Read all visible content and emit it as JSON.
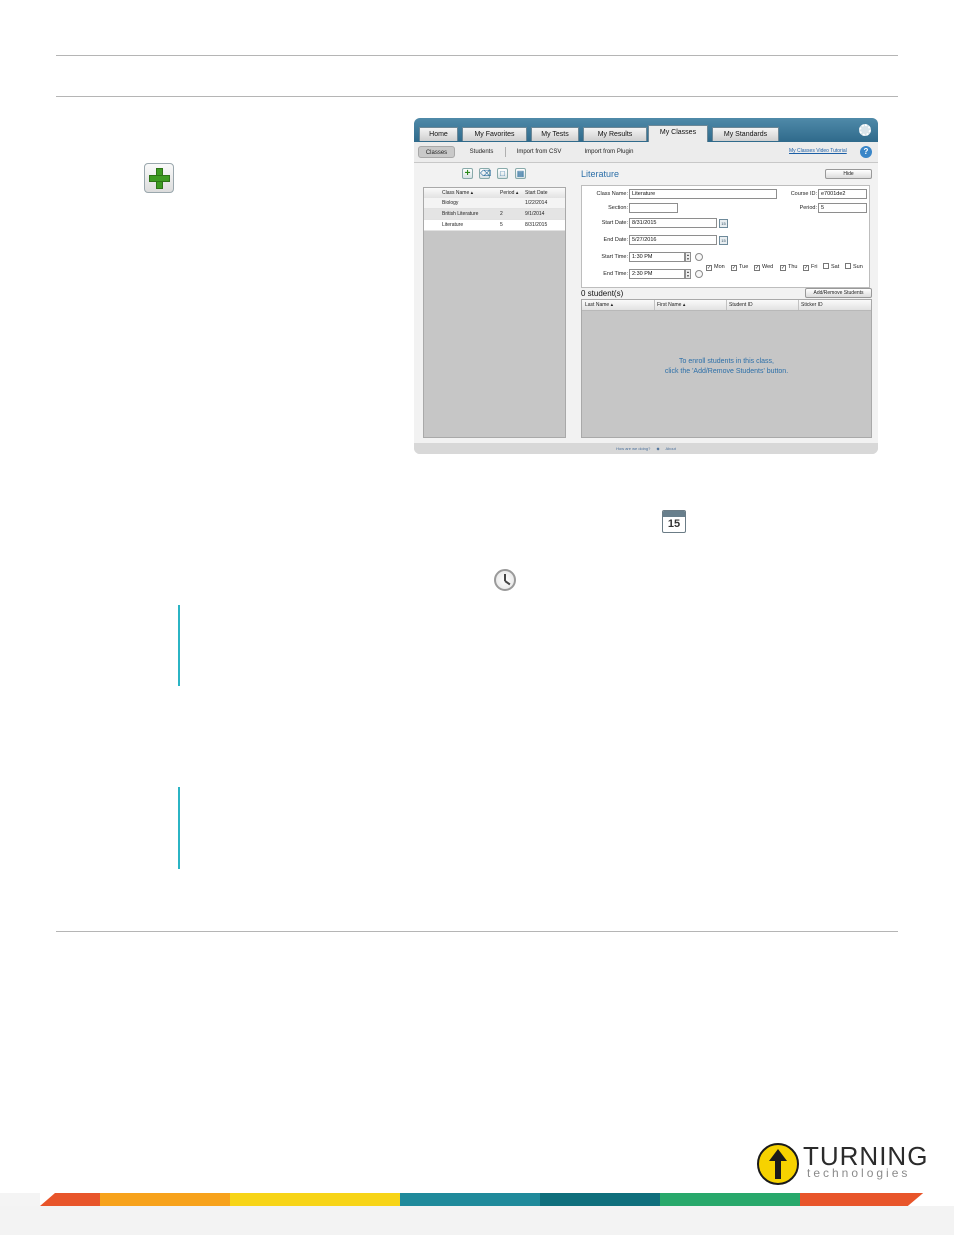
{
  "app": {
    "tabs": [
      "Home",
      "My Favorites",
      "My Tests",
      "My Results",
      "My Classes",
      "My Standards"
    ],
    "active_tab": "My Classes",
    "subtabs": [
      "Classes",
      "Students",
      "Import from CSV",
      "Import from Plugin"
    ],
    "video_link": "My Classes Video Tutorial",
    "help": "?",
    "class_table": {
      "headers": [
        "Class Name ▴",
        "Period ▴",
        "Start Date"
      ],
      "rows": [
        [
          "Biology",
          "",
          "1/22/2014"
        ],
        [
          "British Literature",
          "2",
          "9/1/2014"
        ],
        [
          "Literature",
          "5",
          "8/31/2015"
        ]
      ]
    },
    "detail": {
      "title": "Literature",
      "hide_label": "Hide",
      "class_name_label": "Class Name:",
      "class_name": "Literature",
      "course_id_label": "Course ID:",
      "course_id": "e7001de2",
      "section_label": "Section:",
      "section": "",
      "period_label": "Period:",
      "period": "5",
      "start_date_label": "Start Date:",
      "start_date": "8/31/2015",
      "end_date_label": "End Date:",
      "end_date": "5/27/2016",
      "start_time_label": "Start Time:",
      "start_time": "1:30 PM",
      "end_time_label": "End Time:",
      "end_time": "2:30 PM",
      "days": [
        {
          "label": "Mon",
          "checked": true
        },
        {
          "label": "Tue",
          "checked": true
        },
        {
          "label": "Wed",
          "checked": true
        },
        {
          "label": "Thu",
          "checked": true
        },
        {
          "label": "Fri",
          "checked": true
        },
        {
          "label": "Sat",
          "checked": false
        },
        {
          "label": "Sun",
          "checked": false
        }
      ]
    },
    "students": {
      "count_label": "0 student(s)",
      "add_remove_label": "Add/Remove Students",
      "headers": [
        "Last Name ▴",
        "First Name ▴",
        "Student ID",
        "Sticker ID"
      ],
      "empty_line1": "To enroll students in this class,",
      "empty_line2": "click the 'Add/Remove Students' button."
    },
    "footer": {
      "how": "How are we doing?",
      "sep": "◆",
      "about": "About"
    }
  },
  "calendar_icon_number": "15",
  "logo": {
    "word": "TURNING",
    "sub": "technologies"
  },
  "colors": {
    "accent_bar": "#2bb4c4",
    "stripe": [
      "#e8552a",
      "#f7a21b",
      "#f7d417",
      "#1f8a9b",
      "#28a86b",
      "#0f6f7c"
    ]
  }
}
